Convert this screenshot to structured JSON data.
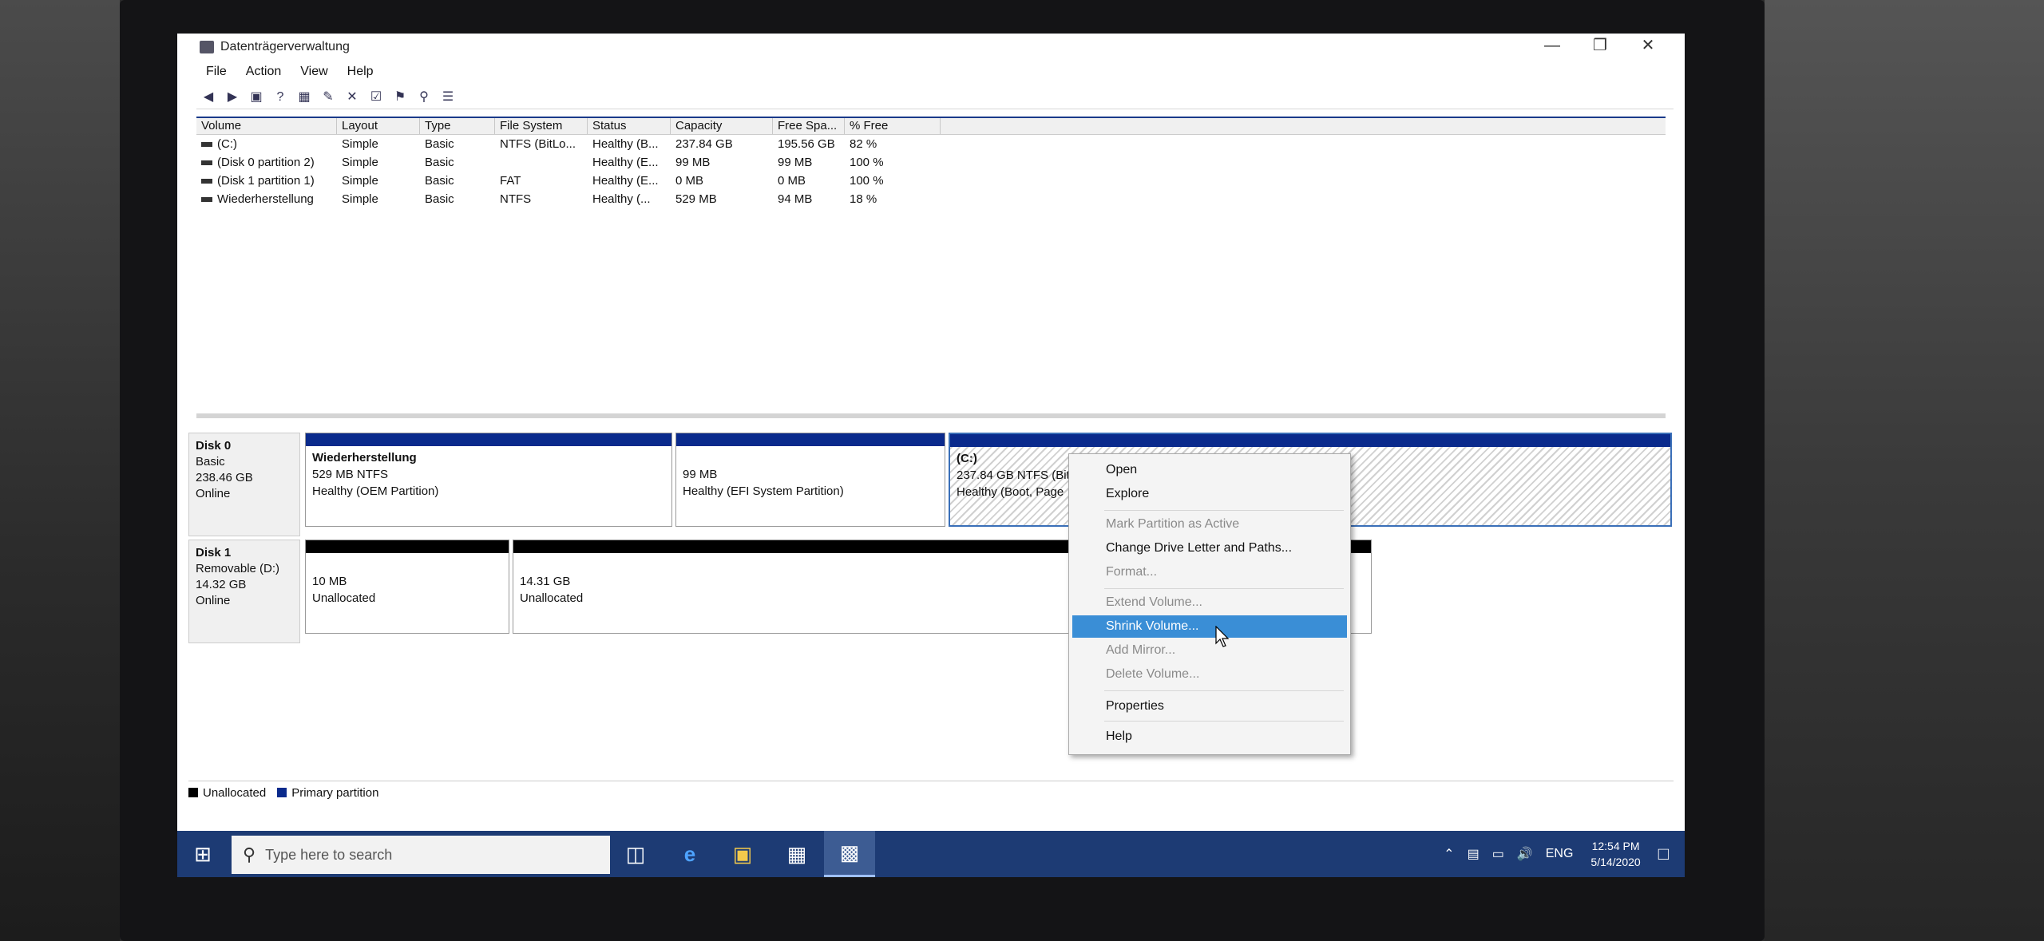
{
  "window": {
    "title": "Datenträgerverwaltung",
    "controls": {
      "minimize": "—",
      "maximize": "❐",
      "close": "✕"
    }
  },
  "menu": [
    "File",
    "Action",
    "View",
    "Help"
  ],
  "toolbar": [
    "back-icon",
    "forward-icon",
    "up-icon",
    "help-icon",
    "properties-icon",
    "connect-icon",
    "delete-icon",
    "check-icon",
    "folder-icon",
    "search-icon",
    "list-icon"
  ],
  "volume_table": {
    "headers": [
      "Volume",
      "Layout",
      "Type",
      "File System",
      "Status",
      "Capacity",
      "Free Spa...",
      "% Free"
    ],
    "rows": [
      [
        "(C:)",
        "Simple",
        "Basic",
        "NTFS (BitLo...",
        "Healthy (B...",
        "237.84 GB",
        "195.56 GB",
        "82 %"
      ],
      [
        "(Disk 0 partition 2)",
        "Simple",
        "Basic",
        "",
        "Healthy (E...",
        "99 MB",
        "99 MB",
        "100 %"
      ],
      [
        "(Disk 1 partition 1)",
        "Simple",
        "Basic",
        "FAT",
        "Healthy (E...",
        "0 MB",
        "0 MB",
        "100 %"
      ],
      [
        "Wiederherstellung",
        "Simple",
        "Basic",
        "NTFS",
        "Healthy (...",
        "529 MB",
        "94 MB",
        "18 %"
      ]
    ]
  },
  "disks": [
    {
      "name": "Disk 0",
      "type": "Basic",
      "size": "238.46 GB",
      "status": "Online",
      "partitions": [
        {
          "title": "Wiederherstellung",
          "line1": "529 MB NTFS",
          "line2": "Healthy (OEM Partition)"
        },
        {
          "title": "",
          "line1": "99 MB",
          "line2": "Healthy (EFI System Partition)"
        },
        {
          "title": "(C:)",
          "line1": "237.84 GB NTFS (BitLocker Encrypted)",
          "line2": "Healthy (Boot, Page"
        }
      ]
    },
    {
      "name": "Disk 1",
      "type": "Removable (D:)",
      "size": "14.32 GB",
      "status": "Online",
      "partitions": [
        {
          "line1": "10 MB",
          "line2": "Unallocated"
        },
        {
          "line1": "14.31 GB",
          "line2": "Unallocated"
        }
      ]
    }
  ],
  "legend": {
    "unallocated": "Unallocated",
    "primary": "Primary partition"
  },
  "context_menu": [
    {
      "label": "Open",
      "enabled": true
    },
    {
      "label": "Explore",
      "enabled": true
    },
    {
      "label": "Mark Partition as Active",
      "enabled": false
    },
    {
      "label": "Change Drive Letter and Paths...",
      "enabled": true
    },
    {
      "label": "Format...",
      "enabled": false
    },
    {
      "label": "Extend Volume...",
      "enabled": false
    },
    {
      "label": "Shrink Volume...",
      "enabled": true,
      "selected": true
    },
    {
      "label": "Add Mirror...",
      "enabled": false
    },
    {
      "label": "Delete Volume...",
      "enabled": false
    },
    {
      "label": "Properties",
      "enabled": true
    },
    {
      "label": "Help",
      "enabled": true
    }
  ],
  "taskbar": {
    "search_placeholder": "Type here to search",
    "language": "ENG",
    "time": "12:54 PM",
    "date": "5/14/2020"
  },
  "colors": {
    "primary_partition": "#0a2a8c",
    "unallocated": "#000000",
    "selection": "#3a8ed6",
    "taskbar": "#1d3b74"
  }
}
